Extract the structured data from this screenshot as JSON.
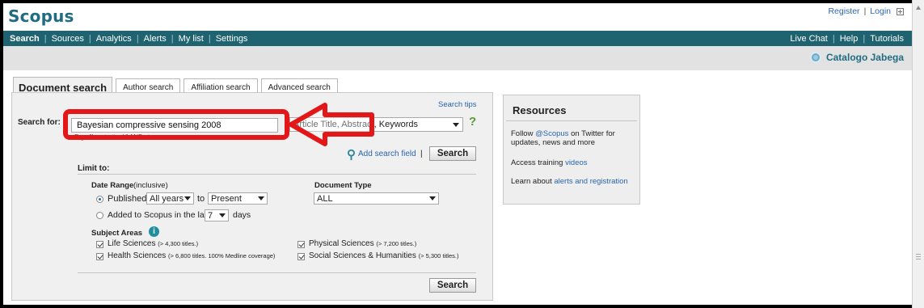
{
  "header": {
    "logo": "Scopus",
    "register": "Register",
    "login": "Login",
    "separator": "|"
  },
  "nav": {
    "left": [
      "Search",
      "Sources",
      "Analytics",
      "Alerts",
      "My list",
      "Settings"
    ],
    "right": [
      "Live Chat",
      "Help",
      "Tutorials"
    ],
    "separator": "|"
  },
  "institution": "Catalogo Jabega",
  "tabs": [
    "Document search",
    "Author search",
    "Affiliation search",
    "Advanced search"
  ],
  "search": {
    "search_tips": "Search tips",
    "search_for_label": "Search for:",
    "query": "Bayesian compressive sensing 2008",
    "example": "E.g., \"heart attack\" AND stress",
    "field_option": "Article Title, Abstract, Keywords",
    "help": "?",
    "add_field": "Add search field",
    "add_sep": "|",
    "search_button": "Search"
  },
  "limits": {
    "limit_to": "Limit to:",
    "date_range_label": "Date Range",
    "date_range_note": "(inclusive)",
    "published_label": "Published",
    "year_from": "All years",
    "to_label": "to",
    "year_to": "Present",
    "added_label": "Added to Scopus in the last",
    "days_value": "7",
    "days_label": "days",
    "doc_type_label": "Document Type",
    "doc_type_value": "ALL",
    "subject_areas_label": "Subject Areas",
    "info_icon": "i",
    "subjects": [
      {
        "name": "Life Sciences",
        "note": "(> 4,300 titles.)"
      },
      {
        "name": "Health Sciences",
        "note": "(> 6,800 titles. 100% Medline coverage)"
      },
      {
        "name": "Physical Sciences",
        "note": "(> 7,200 titles.)"
      },
      {
        "name": "Social Sciences & Humanities",
        "note": "(> 5,300 titles.)"
      }
    ],
    "search_button": "Search"
  },
  "resources": {
    "title": "Resources",
    "follow_pre": "Follow",
    "follow_link": "@Scopus",
    "follow_post1": "on Twitter for",
    "follow_post2": "updates, news and more",
    "training_pre": "Access training",
    "training_link": "videos",
    "learn_pre": "Learn about",
    "learn_link": "alerts and registration"
  },
  "colors": {
    "brand": "#1f6c83",
    "nav_bg": "#1f6270",
    "link": "#2a65b0",
    "annotation": "#e31717"
  }
}
